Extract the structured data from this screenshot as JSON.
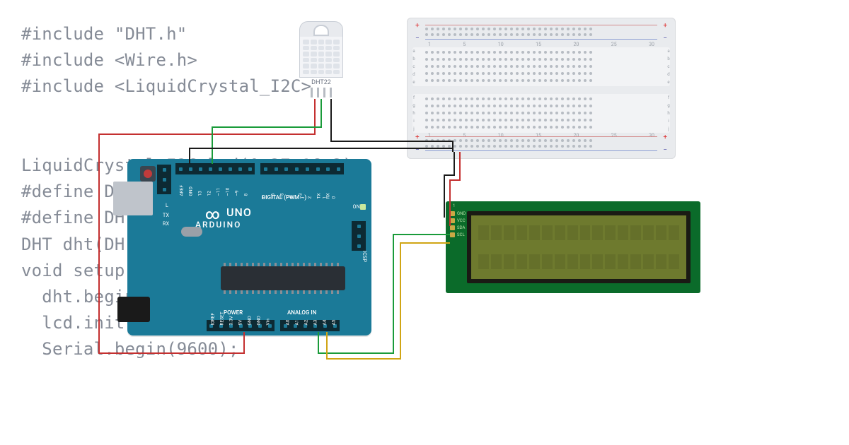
{
  "code_overlay": "#include \"DHT.h\"\n#include <Wire.h>\n#include <LiquidCrystal_I2C>\n\n\nLiquidCrystal_I2C lcd(0x27,16,2);\n#define DHTPIN 12\n#define DHT\nDHT dht(DH\nvoid setup() {\n  dht.begin();\n  lcd.init();\n  Serial.begin(9600);",
  "dht": {
    "label": "DHT22"
  },
  "breadboard": {
    "col_numbers": [
      "1",
      "5",
      "10",
      "15",
      "20",
      "25",
      "30"
    ],
    "rows_upper": [
      "a",
      "b",
      "c",
      "d",
      "e"
    ],
    "rows_lower": [
      "f",
      "g",
      "h",
      "i",
      "j"
    ]
  },
  "arduino": {
    "brand_line1": "UNO",
    "brand_line2": "ARDUINO",
    "section_digital": "DIGITAL (PWM ~)",
    "section_power": "POWER",
    "section_analog": "ANALOG IN",
    "on_label": "ON",
    "tx_label": "TX",
    "rx_label": "RX",
    "l_label": "L",
    "icsp_label": "ICSP",
    "pins_top_left": [
      "AREF",
      "GND",
      "13",
      "12",
      "~11",
      "~10",
      "~9",
      "8"
    ],
    "pins_top_right": [
      "7",
      "~6",
      "~5",
      "4",
      "~3",
      "2",
      "TX 1",
      "RX 0"
    ],
    "pins_bot_left": [
      "IOREF",
      "RESET",
      "3.3V",
      "5V",
      "GND",
      "GND",
      "Vin"
    ],
    "pins_bot_right": [
      "A0",
      "A1",
      "A2",
      "A3",
      "A4",
      "A5"
    ]
  },
  "lcd": {
    "top_label": "1",
    "pins": [
      "GND",
      "VCC",
      "SDA",
      "SCL"
    ]
  }
}
